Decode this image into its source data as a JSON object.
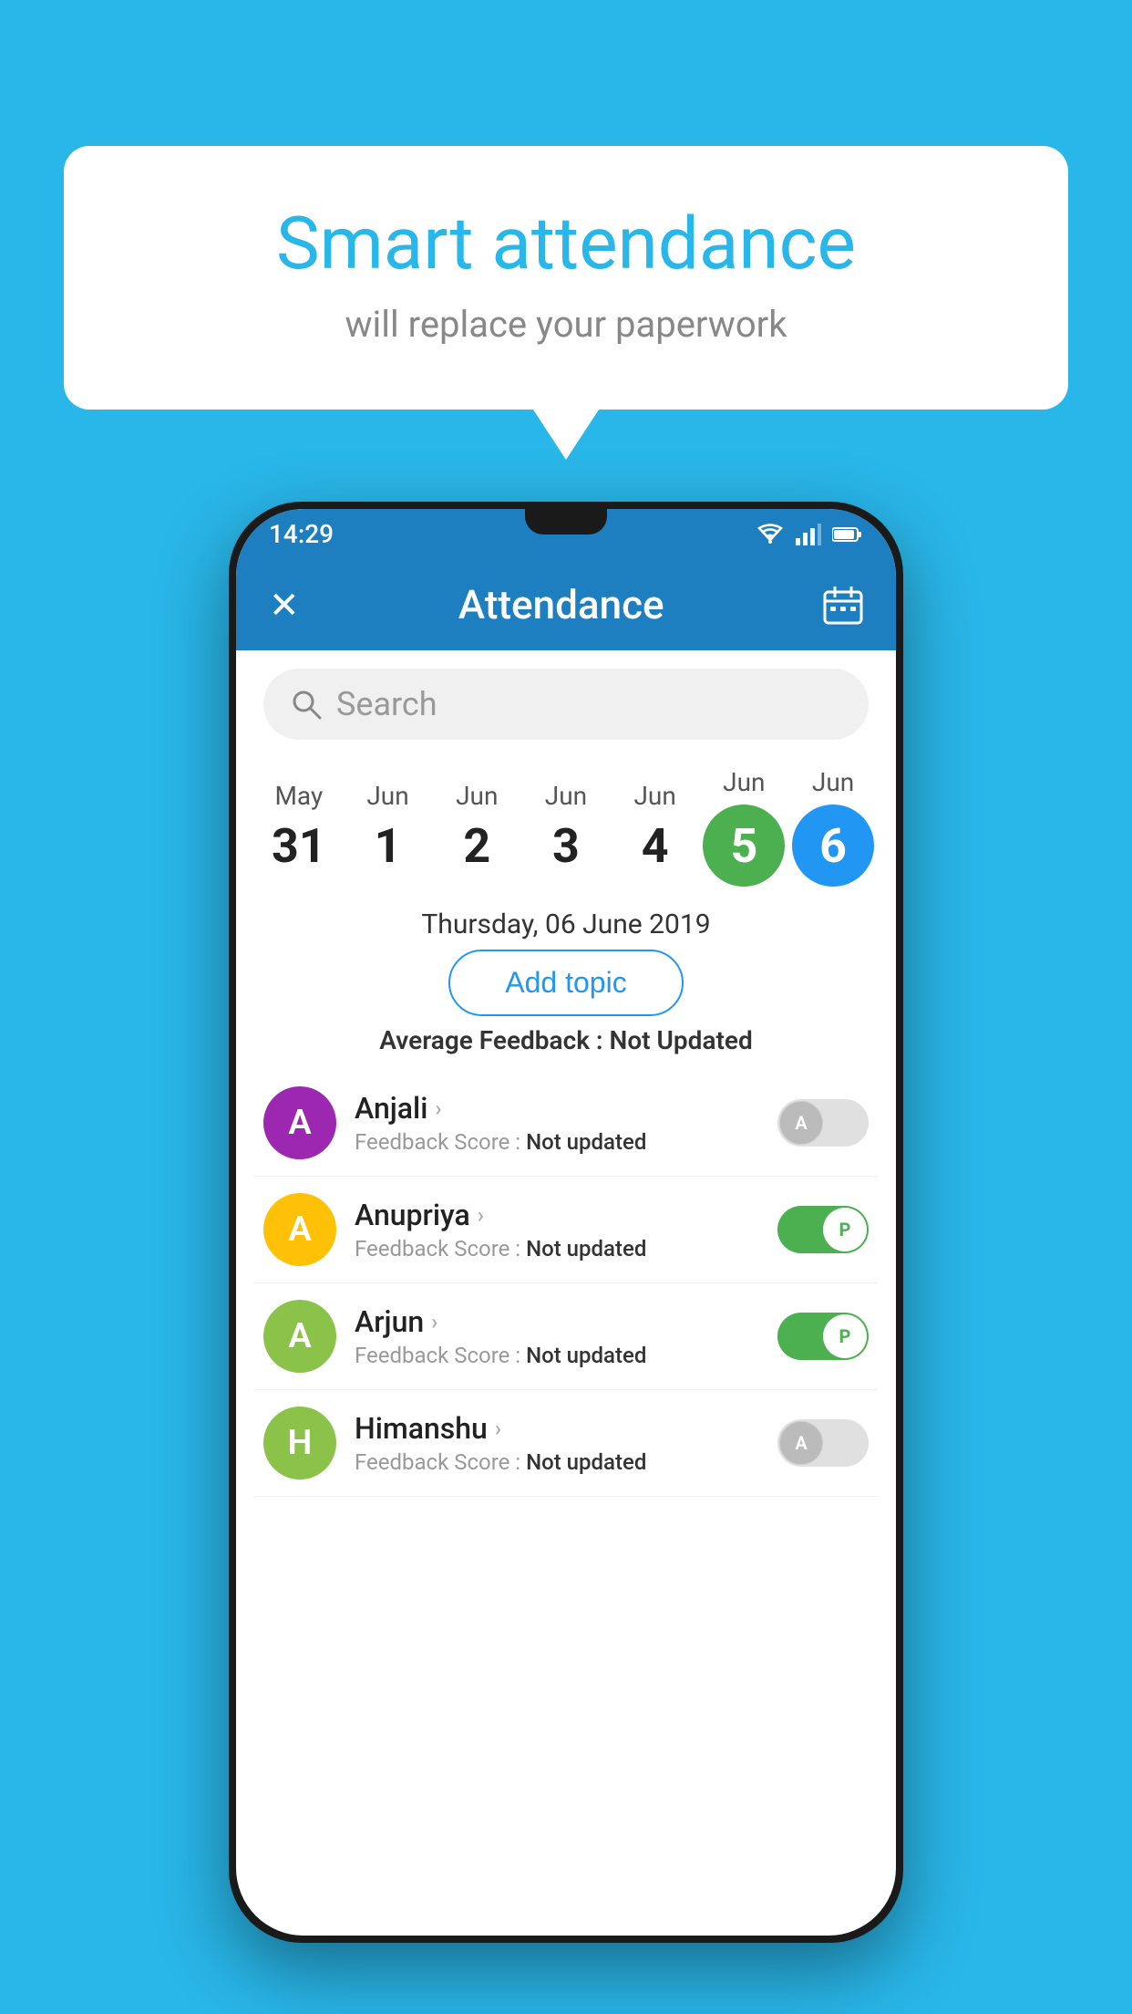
{
  "background_color": "#29b6e8",
  "bubble": {
    "title": "Smart attendance",
    "subtitle": "will replace your paperwork"
  },
  "status_bar": {
    "time": "14:29",
    "icons": [
      "wifi",
      "signal",
      "battery"
    ]
  },
  "app_bar": {
    "title": "Attendance",
    "close_label": "✕",
    "calendar_icon": "📅"
  },
  "search": {
    "placeholder": "Search"
  },
  "calendar": {
    "dates": [
      {
        "month": "May",
        "day": "31"
      },
      {
        "month": "Jun",
        "day": "1"
      },
      {
        "month": "Jun",
        "day": "2"
      },
      {
        "month": "Jun",
        "day": "3"
      },
      {
        "month": "Jun",
        "day": "4"
      },
      {
        "month": "Jun",
        "day": "5",
        "selected_green": true
      },
      {
        "month": "Jun",
        "day": "6",
        "selected_blue": true
      }
    ],
    "selected_label": "Thursday, 06 June 2019"
  },
  "add_topic_label": "Add topic",
  "avg_feedback_label": "Average Feedback :",
  "avg_feedback_value": "Not Updated",
  "students": [
    {
      "name": "Anjali",
      "avatar_letter": "A",
      "avatar_color": "#9c27b0",
      "feedback": "Feedback Score : Not updated",
      "feedback_value": "Not updated",
      "toggle": "off",
      "toggle_label": "A"
    },
    {
      "name": "Anupriya",
      "avatar_letter": "A",
      "avatar_color": "#ffc107",
      "feedback": "Feedback Score : Not updated",
      "feedback_value": "Not updated",
      "toggle": "on",
      "toggle_label": "P"
    },
    {
      "name": "Arjun",
      "avatar_letter": "A",
      "avatar_color": "#8bc34a",
      "feedback": "Feedback Score : Not updated",
      "feedback_value": "Not updated",
      "toggle": "on",
      "toggle_label": "P"
    },
    {
      "name": "Himanshu",
      "avatar_letter": "H",
      "avatar_color": "#8bc34a",
      "feedback": "Feedback Score : Not updated",
      "feedback_value": "Not updated",
      "toggle": "off",
      "toggle_label": "A"
    }
  ]
}
